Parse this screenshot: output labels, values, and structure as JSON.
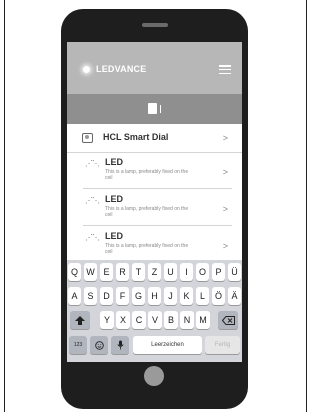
{
  "header": {
    "brand": "LEDVANCE"
  },
  "dial_item": {
    "label": "HCL Smart Dial",
    "chevron": ">"
  },
  "led_items": [
    {
      "title": "LED",
      "description": "This is a lamp, preferably fixed on the ceil",
      "chevron": ">"
    },
    {
      "title": "LED",
      "description": "This is a lamp, preferably fixed on the ceil",
      "chevron": ">"
    },
    {
      "title": "LED",
      "description": "This is a lamp, preferably fixed on the ceil",
      "chevron": ">"
    }
  ],
  "keyboard": {
    "row1": [
      "Q",
      "W",
      "E",
      "R",
      "T",
      "Z",
      "U",
      "I",
      "O",
      "P",
      "Ü"
    ],
    "row2": [
      "A",
      "S",
      "D",
      "F",
      "G",
      "H",
      "J",
      "K",
      "L",
      "Ö",
      "Ä"
    ],
    "row3": [
      "Y",
      "X",
      "C",
      "V",
      "B",
      "N",
      "M"
    ],
    "numbers_key": "123",
    "space_key": "Leerzeichen",
    "done_key": "Fertig"
  },
  "icons": {
    "lamp": "lamp-icon",
    "dial": "dial-icon",
    "menu": "hamburger-menu-icon",
    "shift": "shift-icon",
    "backspace": "backspace-icon",
    "emoji": "emoji-icon",
    "mic": "microphone-icon"
  }
}
